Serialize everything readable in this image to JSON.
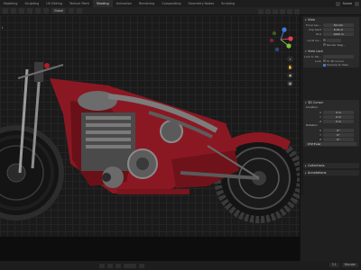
{
  "topbar": {
    "tabs": [
      "Modeling",
      "Sculpting",
      "UV Editing",
      "Texture Paint",
      "Shading",
      "Animation",
      "Rendering",
      "Compositing",
      "Geometry Nodes",
      "Scripting"
    ],
    "active_tab_index": 4,
    "scene_label": "Scene"
  },
  "header": {
    "transform_orientation": "Global",
    "left_label": "t"
  },
  "options_label": "Options",
  "sidebar": {
    "view": {
      "title": "View",
      "focal_length_label": "Focal Len...",
      "focal_length_value": "50 mm",
      "clip_start_label": "Clip Start",
      "clip_start_value": "0.01 m",
      "clip_end_label": "End",
      "clip_end_value": "1000 m",
      "local_camera_label": "Local Ca...",
      "render_region_label": "Render Regi...",
      "view_lock_title": "View Lock",
      "lock_to_object_label": "Lock to Ob...",
      "lock_label": "Lock",
      "to_3d_cursor_label": "To 3D Cursor",
      "camera_to_view_label": "Camera to View"
    },
    "cursor": {
      "title": "3D Cursor",
      "location_label": "Location",
      "x_label": "X",
      "x_value": "0 m",
      "y_label": "Y",
      "y_value": "0 m",
      "z_label": "Z",
      "z_value": "0 m",
      "rotation_label": "Rotation",
      "rx_label": "X",
      "rx_value": "0°",
      "ry_label": "Y",
      "ry_value": "0°",
      "rz_label": "Z",
      "rz_value": "0°",
      "mode_value": "XYZ Euler"
    },
    "collections_title": "Collections",
    "annotations_title": "Annotations"
  },
  "status": {
    "right_items": [
      "3.1",
      "Blender"
    ]
  },
  "colors": {
    "accent_blue": "#4a78c2",
    "body_red": "#8a1822",
    "gizmo_x": "#e0424f",
    "gizmo_y": "#7cbf3a",
    "gizmo_z": "#3f78d8"
  }
}
